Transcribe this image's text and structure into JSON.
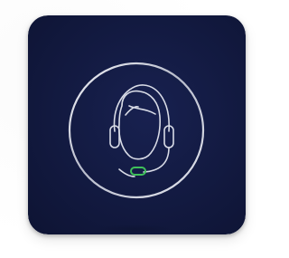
{
  "icon": {
    "name": "customer-support-headset-icon",
    "colors": {
      "tile_dark": "#0e1434",
      "tile_mid": "#182150",
      "stroke": "#d8dbe6",
      "mic_accent": "#3fc15a"
    }
  }
}
